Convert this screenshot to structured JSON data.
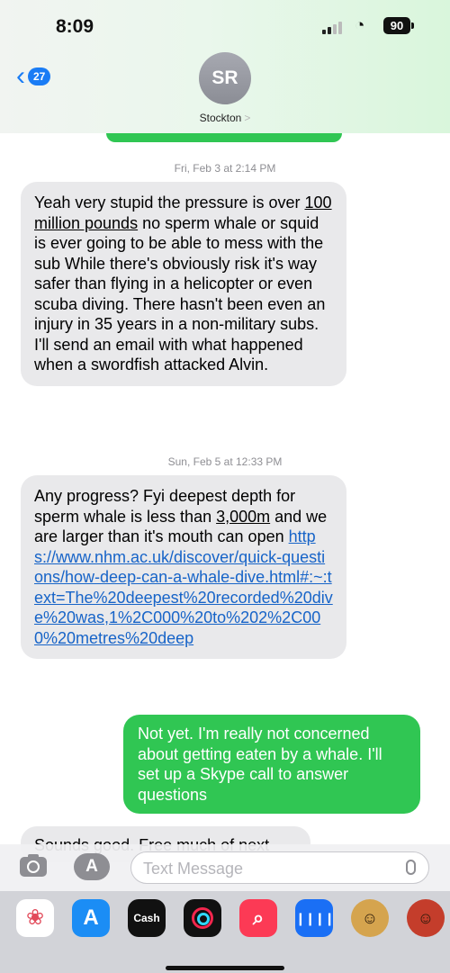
{
  "status": {
    "time": "8:09",
    "battery": "90"
  },
  "header": {
    "back_count": "27",
    "avatar_initials": "SR",
    "contact_name": "Stockton",
    "contact_chevron": ">"
  },
  "thread": {
    "ts1": "Fri, Feb 3 at 2:14 PM",
    "msg1": {
      "line1": "Yeah very stupid the pressure is over",
      "underlined": "100 million pounds",
      "line2_rest": " no sperm whale",
      "rest": "or squid is ever going to be able to mess with the sub While there's obviously risk it's way safer than flying in a helicopter or even scuba diving. There hasn't been even an injury in 35 years in a non-military subs. I'll send an email with what happened when a swordfish attacked Alvin."
    },
    "ts2": "Sun, Feb 5 at 12:33 PM",
    "msg2": {
      "text_start": "Any progress? Fyi deepest depth for sperm whale is less than ",
      "underlined": "3,000m",
      "text_end": " and we are larger than it's mouth can open ",
      "link": "https://www.nhm.ac.uk/discover/quick-questions/how-deep-can-a-whale-dive.html#:~:text=The%20deepest%20recorded%20dive%20was,1%2C000%20to%202%2C000%20metres%20deep"
    },
    "msg3": "Not yet.  I'm really not concerned about getting eaten by a whale. I'll set up a Skype call to answer questions",
    "msg4_partial": "Sounds good. Free much of next"
  },
  "input": {
    "placeholder": "Text Message",
    "apps_label": "A"
  },
  "drawer": {
    "apps": [
      "photos-icon",
      "app-store-icon",
      "cash-app-icon",
      "fitness-icon",
      "image-search-icon",
      "audio-message-icon",
      "memoji-icon",
      "memoji-stickers-icon"
    ],
    "cash_label": "Cash"
  }
}
